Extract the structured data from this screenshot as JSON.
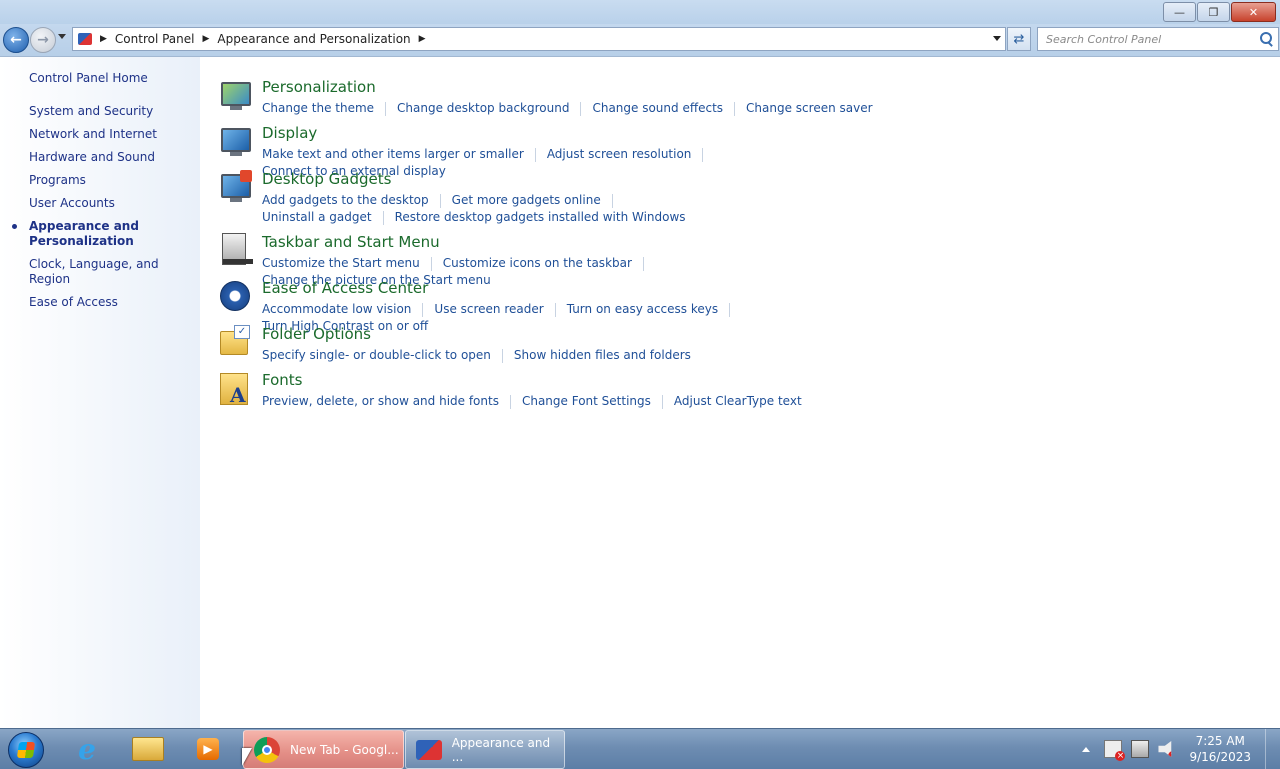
{
  "window": {
    "minimize_icon": "minimize-icon",
    "restore_icon": "restore-icon",
    "close_icon": "close-icon"
  },
  "nav": {
    "breadcrumb": [
      "Control Panel",
      "Appearance and Personalization"
    ],
    "search_placeholder": "Search Control Panel"
  },
  "sidebar": {
    "home": "Control Panel Home",
    "items": [
      "System and Security",
      "Network and Internet",
      "Hardware and Sound",
      "Programs",
      "User Accounts",
      "Appearance and Personalization",
      "Clock, Language, and Region",
      "Ease of Access"
    ],
    "active_index": 5
  },
  "categories": [
    {
      "title": "Personalization",
      "icon": "personalization-icon",
      "links": [
        "Change the theme",
        "Change desktop background",
        "Change sound effects",
        "Change screen saver"
      ]
    },
    {
      "title": "Display",
      "icon": "display-icon",
      "links": [
        "Make text and other items larger or smaller",
        "Adjust screen resolution",
        "Connect to an external display"
      ]
    },
    {
      "title": "Desktop Gadgets",
      "icon": "desktop-gadgets-icon",
      "links": [
        "Add gadgets to the desktop",
        "Get more gadgets online",
        "Uninstall a gadget",
        "Restore desktop gadgets installed with Windows"
      ]
    },
    {
      "title": "Taskbar and Start Menu",
      "icon": "taskbar-icon",
      "links": [
        "Customize the Start menu",
        "Customize icons on the taskbar",
        "Change the picture on the Start menu"
      ]
    },
    {
      "title": "Ease of Access Center",
      "icon": "ease-of-access-icon",
      "links": [
        "Accommodate low vision",
        "Use screen reader",
        "Turn on easy access keys",
        "Turn High Contrast on or off"
      ]
    },
    {
      "title": "Folder Options",
      "icon": "folder-options-icon",
      "links": [
        "Specify single- or double-click to open",
        "Show hidden files and folders"
      ]
    },
    {
      "title": "Fonts",
      "icon": "fonts-icon",
      "links": [
        "Preview, delete, or show and hide fonts",
        "Change Font Settings",
        "Adjust ClearType text"
      ]
    }
  ],
  "taskbar": {
    "tasks": [
      {
        "label": "New Tab - Googl...",
        "icon": "chrome-icon"
      },
      {
        "label": "Appearance and ...",
        "icon": "control-panel-icon"
      }
    ],
    "time": "7:25 AM",
    "date": "9/16/2023"
  },
  "colors": {
    "link": "#1f4f97",
    "category_title": "#1b6a2c",
    "sidebar_link": "#1e3287",
    "chrome_task_bg": "#e38e86"
  }
}
